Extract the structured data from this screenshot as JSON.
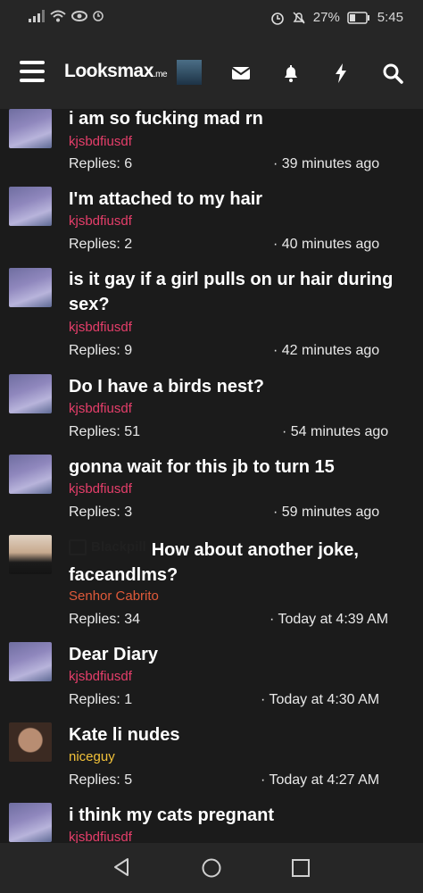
{
  "statusbar": {
    "battery": "27%",
    "time": "5:45"
  },
  "app": {
    "logo_main": "Looksmax",
    "logo_suffix": ".me"
  },
  "threads": [
    {
      "title": "i am so fucking mad rn",
      "author": "kjsbdfiusdf",
      "replies": "Replies: 6",
      "time": "· 39 minutes ago"
    },
    {
      "title": "I'm attached to my hair",
      "author": "kjsbdfiusdf",
      "replies": "Replies: 2",
      "time": "· 40 minutes ago"
    },
    {
      "title": "is it gay if a girl pulls on ur hair during sex?",
      "author": "kjsbdfiusdf",
      "replies": "Replies: 9",
      "time": "· 42 minutes ago"
    },
    {
      "title": "Do I have a birds nest?",
      "author": "kjsbdfiusdf",
      "replies": "Replies: 51",
      "time": "· 54 minutes ago"
    },
    {
      "title": "gonna wait for this jb to turn 15",
      "author": "kjsbdfiusdf",
      "replies": "Replies: 3",
      "time": "· 59 minutes ago"
    },
    {
      "prefix": "Blackpill",
      "title": "How about another joke, faceandlms?",
      "author": "Senhor Cabrito",
      "replies": "Replies: 34",
      "time": "· Today at 4:39 AM"
    },
    {
      "title": "Dear Diary",
      "author": "kjsbdfiusdf",
      "replies": "Replies: 1",
      "time": "· Today at 4:30 AM"
    },
    {
      "title": "Kate li nudes",
      "author": "niceguy",
      "replies": "Replies: 5",
      "time": "· Today at 4:27 AM"
    },
    {
      "title": "i think my cats pregnant",
      "author": "kjsbdfiusdf"
    }
  ],
  "colors": {
    "author_pink": "#e53e6a",
    "author_red": "#e05a3a",
    "author_yellow": "#f2c23a"
  }
}
